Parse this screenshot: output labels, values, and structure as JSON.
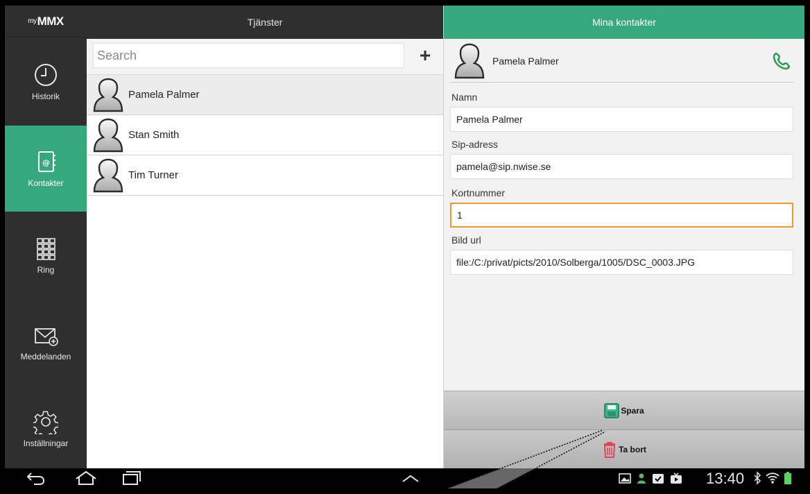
{
  "app": {
    "logo_prefix": "my",
    "logo_main": "MMX"
  },
  "sidebar": {
    "items": [
      {
        "label": "Historik",
        "icon": "clock-icon",
        "active": false
      },
      {
        "label": "Kontakter",
        "icon": "address-book-icon",
        "active": true
      },
      {
        "label": "Ring",
        "icon": "dialpad-icon",
        "active": false
      },
      {
        "label": "Meddelanden",
        "icon": "envelope-icon",
        "active": false
      },
      {
        "label": "Inställningar",
        "icon": "gear-icon",
        "active": false
      }
    ]
  },
  "services": {
    "title": "Tjänster",
    "search_placeholder": "Search",
    "add_label": "+",
    "contacts": [
      "Pamela Palmer",
      "Stan Smith",
      "Tim Turner"
    ]
  },
  "details": {
    "title": "Mina kontakter",
    "contact_name": "Pamela Palmer",
    "fields": {
      "name_label": "Namn",
      "name_value": "Pamela Palmer",
      "sip_label": "Sip-adress",
      "sip_value": "pamela@sip.nwise.se",
      "short_label": "Kortnummer",
      "short_value": "1",
      "url_label": "Bild url",
      "url_value": "file:/C:/privat/picts/2010/Solberga/1005/DSC_0003.JPG"
    },
    "save_label": "Spara",
    "delete_label": "Ta bort"
  },
  "statusbar": {
    "time": "13:40"
  },
  "colors": {
    "accent": "#35a87f",
    "sidebar": "#2f2f2f",
    "focus": "#f09a2a",
    "phone": "#2f9a5a",
    "trash": "#e23b4a"
  }
}
